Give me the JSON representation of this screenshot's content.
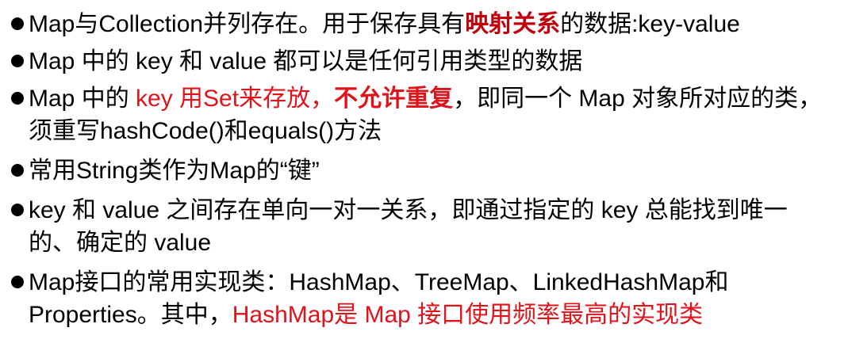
{
  "bullets": [
    {
      "segments": [
        {
          "text": "Map与Collection并列存在。用于保存具有",
          "style": "normal"
        },
        {
          "text": "映射关系",
          "style": "darkred-bold"
        },
        {
          "text": "的数据:key-value",
          "style": "normal"
        }
      ]
    },
    {
      "segments": [
        {
          "text": "Map 中的 key 和  value 都可以是任何引用类型的数据",
          "style": "normal"
        }
      ]
    },
    {
      "segments": [
        {
          "text": "Map 中的 ",
          "style": "normal"
        },
        {
          "text": "key 用Set来存放，",
          "style": "red"
        },
        {
          "text": "不允许重复",
          "style": "red-bold"
        },
        {
          "text": "，即同一个 Map 对象所对应的类，须重写hashCode()和equals()方法",
          "style": "normal"
        }
      ]
    },
    {
      "segments": [
        {
          "text": "常用String类作为Map的“键”",
          "style": "normal"
        }
      ]
    },
    {
      "segments": [
        {
          "text": "key 和 value 之间存在单向一对一关系，即通过指定的 key 总能找到唯一的、确定的 value",
          "style": "normal"
        }
      ]
    },
    {
      "segments": [
        {
          "text": "Map接口的常用实现类：HashMap、TreeMap、LinkedHashMap和Properties。其中，",
          "style": "normal"
        },
        {
          "text": "HashMap是 Map 接口使用频率最高的实现类",
          "style": "red"
        }
      ]
    }
  ]
}
